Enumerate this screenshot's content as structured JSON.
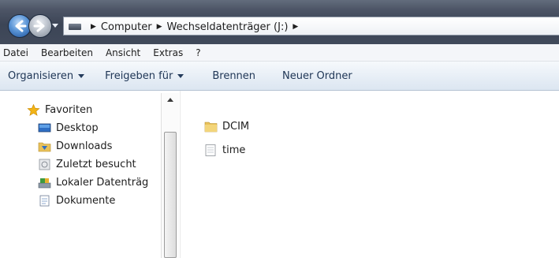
{
  "address_bar": {
    "crumbs": [
      "Computer",
      "Wechseldatenträger (J:)"
    ]
  },
  "menu": [
    "Datei",
    "Bearbeiten",
    "Ansicht",
    "Extras",
    "?"
  ],
  "toolbar": {
    "organize": "Organisieren",
    "share": "Freigeben für",
    "burn": "Brennen",
    "new_folder": "Neuer Ordner"
  },
  "navigation": {
    "favorites": "Favoriten",
    "items": [
      "Desktop",
      "Downloads",
      "Zuletzt besucht",
      "Lokaler Datenträg",
      "Dokumente"
    ]
  },
  "files": [
    {
      "name": "DCIM",
      "icon": "folder-icon"
    },
    {
      "name": "time",
      "icon": "text-file-icon"
    }
  ],
  "colors": {
    "title_bar": "#414a5b",
    "toolbar_text": "#1e3555",
    "folder": "#e8c15a"
  }
}
